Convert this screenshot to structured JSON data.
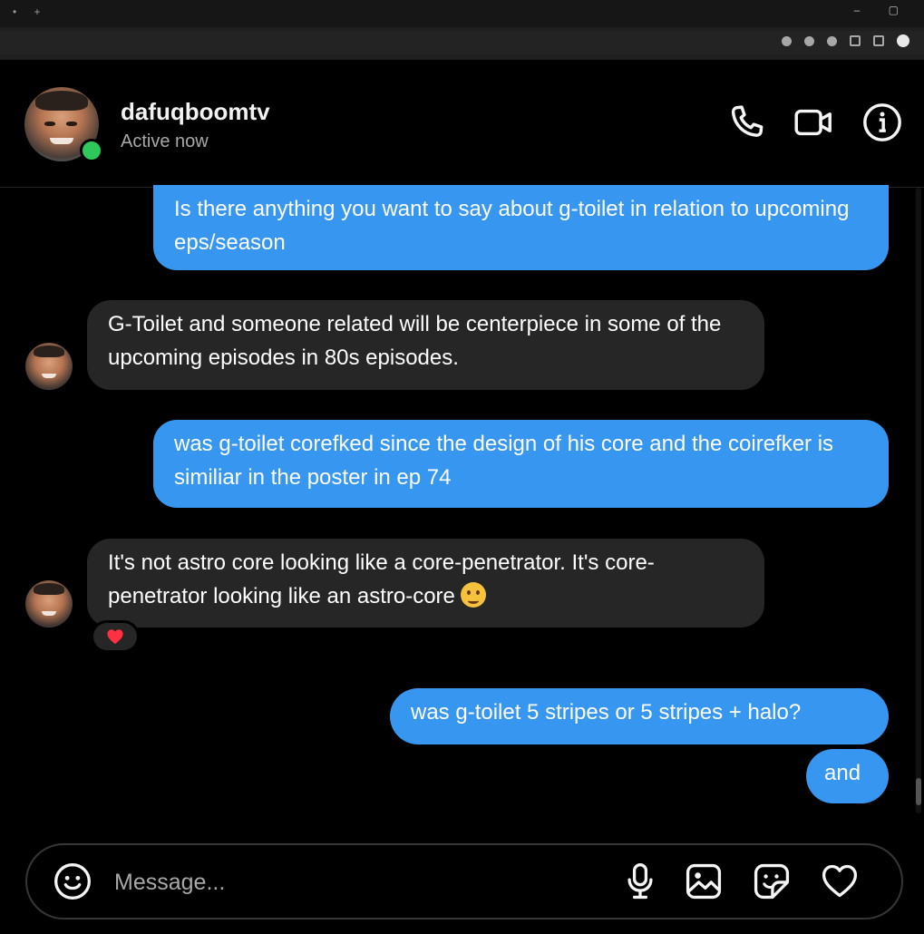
{
  "browser": {
    "tab_dots": "• +",
    "window_controls": "– ▢"
  },
  "header": {
    "username": "dafuqboomtv",
    "status": "Active now",
    "actions": [
      "phone-icon",
      "video-camera-icon",
      "info-icon"
    ]
  },
  "messages": [
    {
      "side": "out",
      "text": "Is there anything you want to say about g-toilet in relation to upcoming eps/season"
    },
    {
      "side": "in",
      "text": "G-Toilet and someone related will be centerpiece in some of the upcoming episodes in 80s episodes."
    },
    {
      "side": "out",
      "text": "was g-toilet corefked since the design of his core and the coirefker is similiar in the poster in ep 74"
    },
    {
      "side": "in",
      "text": "It's not astro core looking like a core-penetrator. It's core-penetrator looking like an astro-core",
      "emoji": "smiling-face-emoji",
      "reaction": "heart"
    },
    {
      "side": "out",
      "text": "was g-toilet 5 stripes or 5 stripes + halo?"
    },
    {
      "side": "out",
      "text": "and"
    }
  ],
  "composer": {
    "placeholder": "Message...",
    "icons": [
      "smiley-icon",
      "microphone-icon",
      "image-icon",
      "sticker-icon",
      "heart-icon"
    ]
  },
  "colors": {
    "outgoing_bubble": "#3797f0",
    "incoming_bubble": "#262626",
    "online": "#2ec95a",
    "reaction_heart": "#ff3040"
  }
}
